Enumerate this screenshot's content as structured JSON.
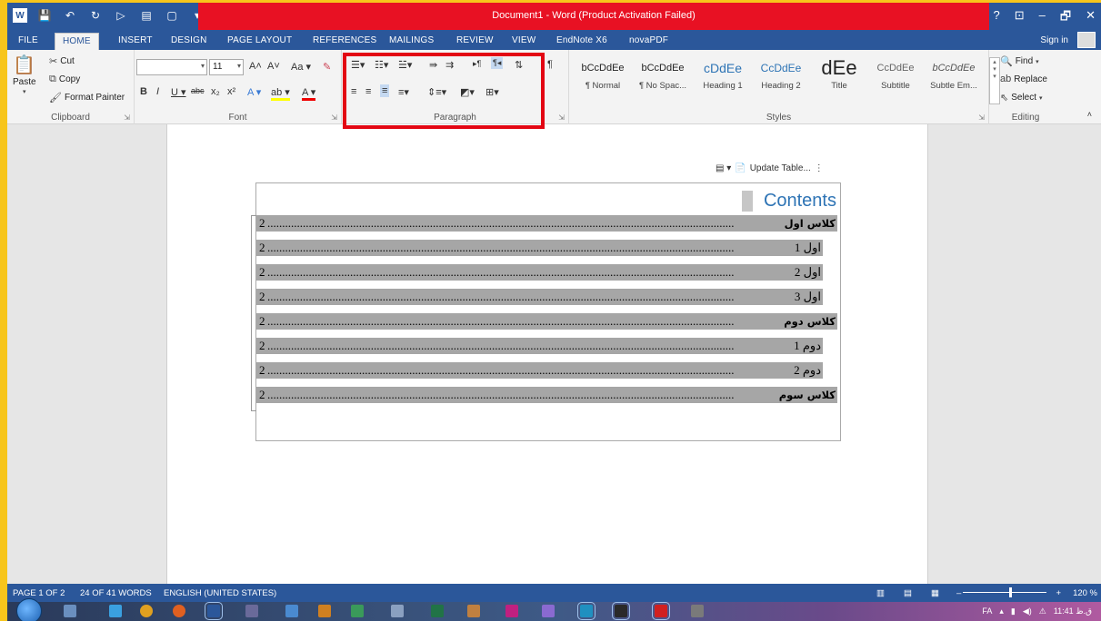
{
  "window": {
    "title": "Document1 - Word (Product Activation Failed)",
    "controls": [
      "?",
      "⊡",
      "–",
      "🗗",
      "✕"
    ]
  },
  "tabs": [
    "FILE",
    "HOME",
    "INSERT",
    "DESIGN",
    "PAGE LAYOUT",
    "REFERENCES",
    "MAILINGS",
    "REVIEW",
    "VIEW",
    "EndNote X6",
    "novaPDF"
  ],
  "active_tab": "HOME",
  "signin": "Sign in",
  "clipboard": {
    "label": "Clipboard",
    "paste": "Paste",
    "cut": "Cut",
    "copy": "Copy",
    "format_painter": "Format Painter"
  },
  "font": {
    "label": "Font",
    "family": "",
    "size": "11",
    "case_label": "Aa"
  },
  "paragraph": {
    "label": "Paragraph"
  },
  "styles": {
    "label": "Styles",
    "items": [
      {
        "preview": "bCcDdEe",
        "name": "¶ Normal"
      },
      {
        "preview": "bCcDdEe",
        "name": "¶ No Spac..."
      },
      {
        "preview": "cDdEe",
        "name": "Heading 1"
      },
      {
        "preview": "CcDdEe",
        "name": "Heading 2"
      },
      {
        "preview": "dEe",
        "name": "Title"
      },
      {
        "preview": "CcDdEe",
        "name": "Subtitle"
      },
      {
        "preview": "bCcDdEe",
        "name": "Subtle Em..."
      }
    ]
  },
  "editing": {
    "label": "Editing",
    "find": "Find",
    "replace": "Replace",
    "select": "Select"
  },
  "toc": {
    "update_label": "Update Table...",
    "title": "Contents",
    "rows": [
      {
        "text": "كلاس اول",
        "page": "2",
        "bold": true
      },
      {
        "text": "اول 1",
        "page": "2",
        "bold": false
      },
      {
        "text": "اول 2",
        "page": "2",
        "bold": false
      },
      {
        "text": "اول 3",
        "page": "2",
        "bold": false
      },
      {
        "text": "كلاس دوم",
        "page": "2",
        "bold": true
      },
      {
        "text": "دوم 1",
        "page": "2",
        "bold": false
      },
      {
        "text": "دوم 2",
        "page": "2",
        "bold": false
      },
      {
        "text": "كلاس سوم",
        "page": "2",
        "bold": true
      }
    ]
  },
  "status": {
    "page": "PAGE 1 OF 2",
    "words": "24 OF 41 WORDS",
    "language": "ENGLISH (UNITED STATES)",
    "zoom": "120 %"
  },
  "taskbar": {
    "lang": "FA",
    "time": "11:41 ق.ظ"
  },
  "colors": {
    "word_blue": "#2b579a",
    "title_red": "#e81123",
    "highlight_red": "#e30613",
    "frame_yellow": "#f7c51b",
    "toc_gray": "#a6a6a6",
    "heading_blue": "#2e74b5"
  }
}
